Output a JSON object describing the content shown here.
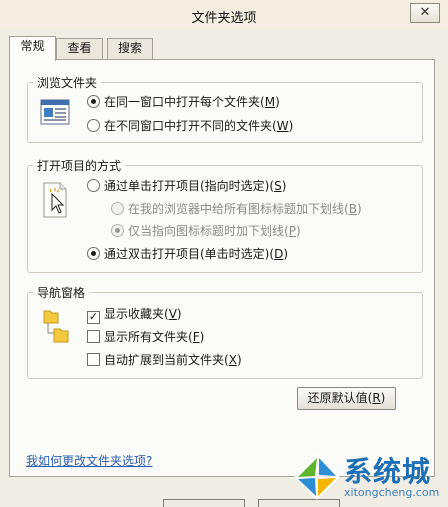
{
  "window": {
    "title": "文件夹选项",
    "close_label": "✕"
  },
  "tabs": [
    {
      "label": "常规",
      "active": true
    },
    {
      "label": "查看",
      "active": false
    },
    {
      "label": "搜索",
      "active": false
    }
  ],
  "browse_folders": {
    "title": "浏览文件夹",
    "options": [
      {
        "text": "在同一窗口中打开每个文件夹",
        "key": "M",
        "checked": true
      },
      {
        "text": "在不同窗口中打开不同的文件夹",
        "key": "W",
        "checked": false
      }
    ]
  },
  "click_items": {
    "title": "打开项目的方式",
    "single_click": {
      "text": "通过单击打开项目(指向时选定)",
      "key": "S",
      "checked": false
    },
    "underline_browser": {
      "text": "在我的浏览器中给所有图标标题加下划线",
      "key": "B",
      "checked": false
    },
    "underline_hover": {
      "text": "仅当指向图标标题时加下划线",
      "key": "P",
      "checked": true
    },
    "double_click": {
      "text": "通过双击打开项目(单击时选定)",
      "key": "D",
      "checked": true
    }
  },
  "navigation_pane": {
    "title": "导航窗格",
    "options": [
      {
        "text": "显示收藏夹",
        "key": "V",
        "checked": true
      },
      {
        "text": "显示所有文件夹",
        "key": "F",
        "checked": false
      },
      {
        "text": "自动扩展到当前文件夹",
        "key": "X",
        "checked": false
      }
    ]
  },
  "restore_defaults": {
    "text": "还原默认值",
    "key": "R"
  },
  "help_link": "我如何更改文件夹选项?",
  "watermark": {
    "name": "系统城",
    "url": "xitongcheng.com"
  },
  "colors": {
    "link": "#2a5db0",
    "brand_blue": "#1d6fb6",
    "brand_green": "#5fb530"
  }
}
